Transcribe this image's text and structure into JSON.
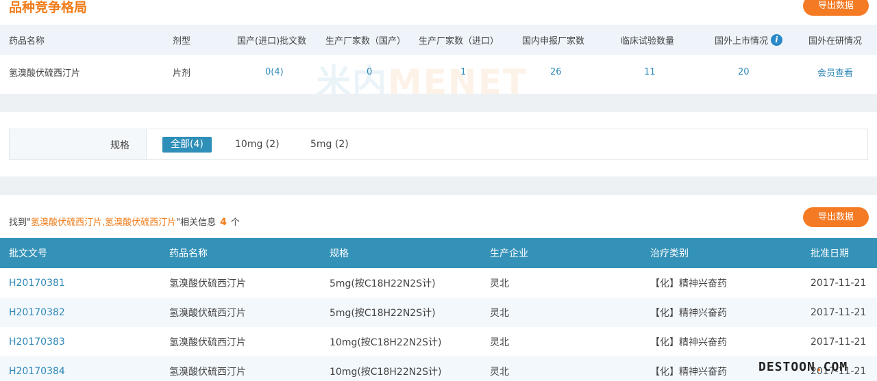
{
  "header": {
    "title": "品种竞争格局",
    "export_label": "导出数据"
  },
  "competition": {
    "columns": [
      "药品名称",
      "剂型",
      "国产(进口)批文数",
      "生产厂家数（国产）",
      "生产厂家数（进口）",
      "国内申报厂家数",
      "临床试验数量",
      "国外上市情况",
      "国外在研情况"
    ],
    "info_icon": "i",
    "row": {
      "name": "氢溴酸伏硫西汀片",
      "form": "片剂",
      "approvals": "0(4)",
      "mfr_domestic": "0",
      "mfr_import": "1",
      "domestic_applicants": "26",
      "clinical_trials": "11",
      "foreign_market": "20",
      "foreign_research": "会员查看"
    },
    "watermark_a": "米内",
    "watermark_b": "MENET"
  },
  "spec_filter": {
    "label": "规格",
    "options": [
      "全部(4)",
      "10mg (2)",
      "5mg (2)"
    ],
    "selected": "全部(4)"
  },
  "results": {
    "found_prefix": "找到\"",
    "keyword": "氢溴酸伏硫西汀片,氢溴酸伏硫西汀片",
    "found_mid": "\"相关信息",
    "count": "4",
    "found_suffix": "个",
    "export_label": "导出数据",
    "columns": [
      "批文文号",
      "药品名称",
      "规格",
      "生产企业",
      "治疗类别",
      "批准日期"
    ],
    "rows": [
      {
        "code": "H20170381",
        "name": "氢溴酸伏硫西汀片",
        "spec": "5mg(按C18H22N2S计)",
        "company": "灵北",
        "category": "【化】精神兴奋药",
        "date": "2017-11-21"
      },
      {
        "code": "H20170382",
        "name": "氢溴酸伏硫西汀片",
        "spec": "5mg(按C18H22N2S计)",
        "company": "灵北",
        "category": "【化】精神兴奋药",
        "date": "2017-11-21"
      },
      {
        "code": "H20170383",
        "name": "氢溴酸伏硫西汀片",
        "spec": "10mg(按C18H22N2S计)",
        "company": "灵北",
        "category": "【化】精神兴奋药",
        "date": "2017-11-21"
      },
      {
        "code": "H20170384",
        "name": "氢溴酸伏硫西汀片",
        "spec": "10mg(按C18H22N2S计)",
        "company": "灵北",
        "category": "【化】精神兴奋药",
        "date": "2017-11-21"
      }
    ]
  },
  "footer": {
    "brand_a": "DESTOON",
    "brand_dot": ".",
    "brand_b": "COM"
  },
  "colors": {
    "accent_orange": "#f47a24",
    "header_blue": "#3492b8",
    "link_blue": "#2f88b8"
  }
}
